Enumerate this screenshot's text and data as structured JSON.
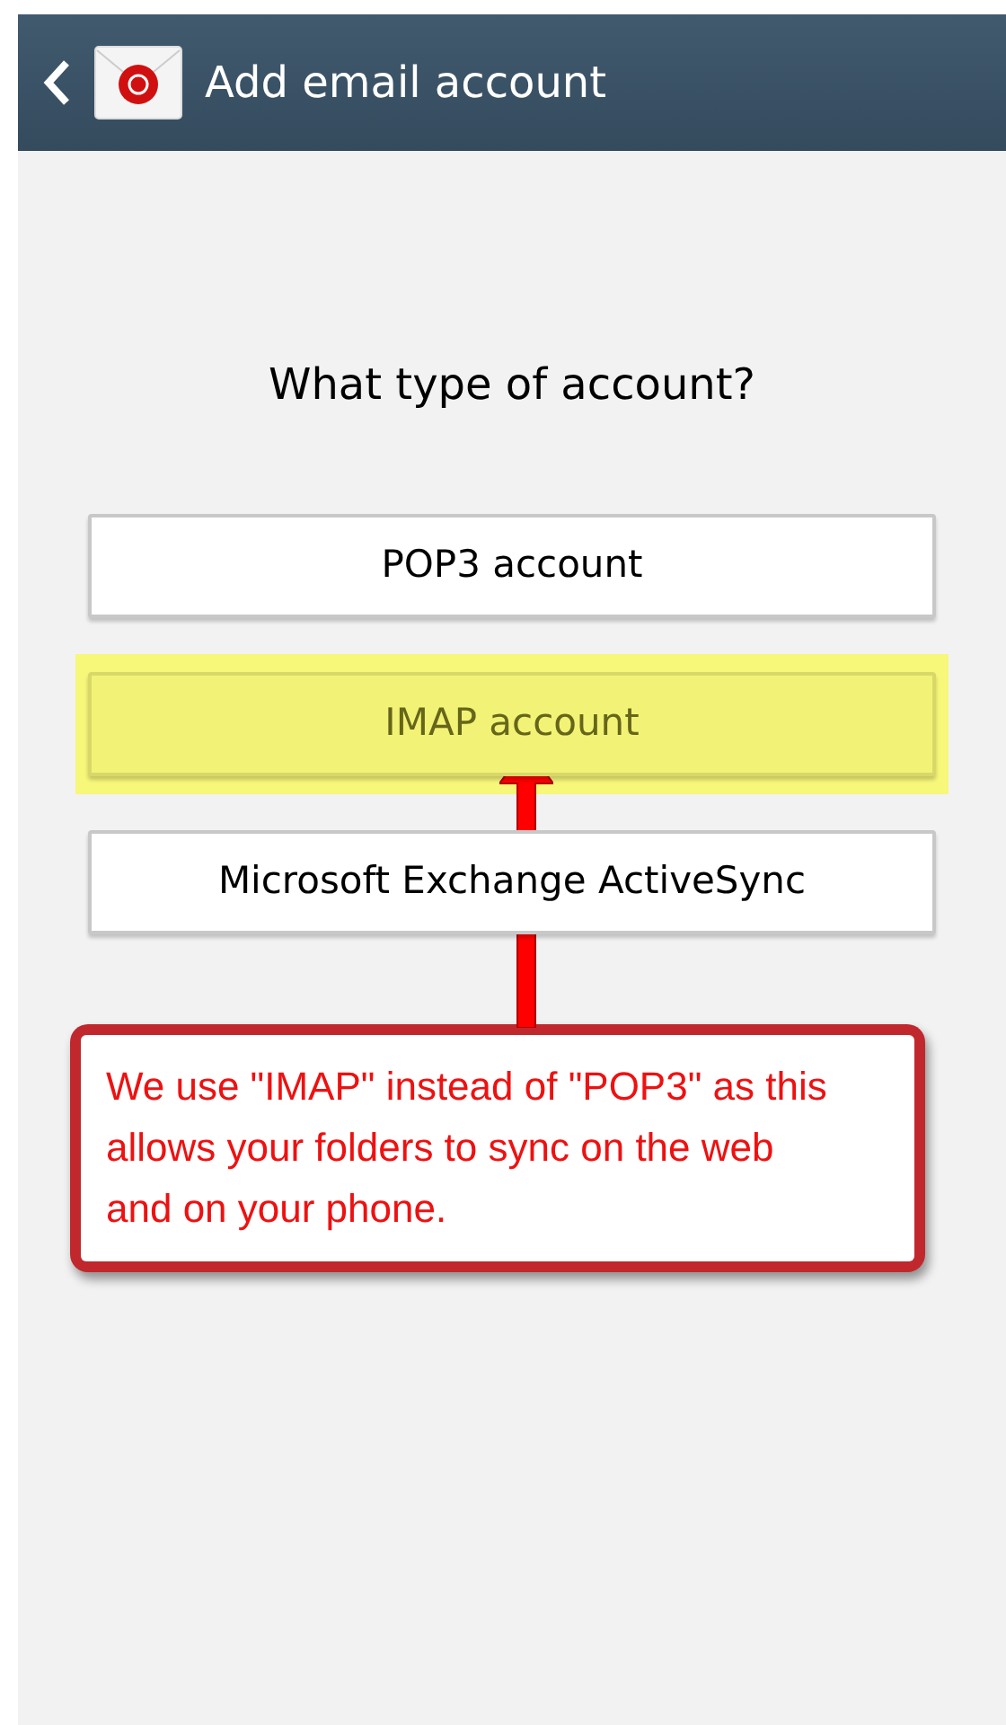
{
  "header": {
    "title": "Add email account"
  },
  "prompt": "What type of account?",
  "options": [
    {
      "label": "POP3 account",
      "highlighted": false
    },
    {
      "label": "IMAP account",
      "highlighted": true
    },
    {
      "label": "Microsoft Exchange ActiveSync",
      "highlighted": false
    }
  ],
  "callout": {
    "text": "We use \"IMAP\" instead of \"POP3\" as this allows your folders to sync on the web and on your phone."
  }
}
